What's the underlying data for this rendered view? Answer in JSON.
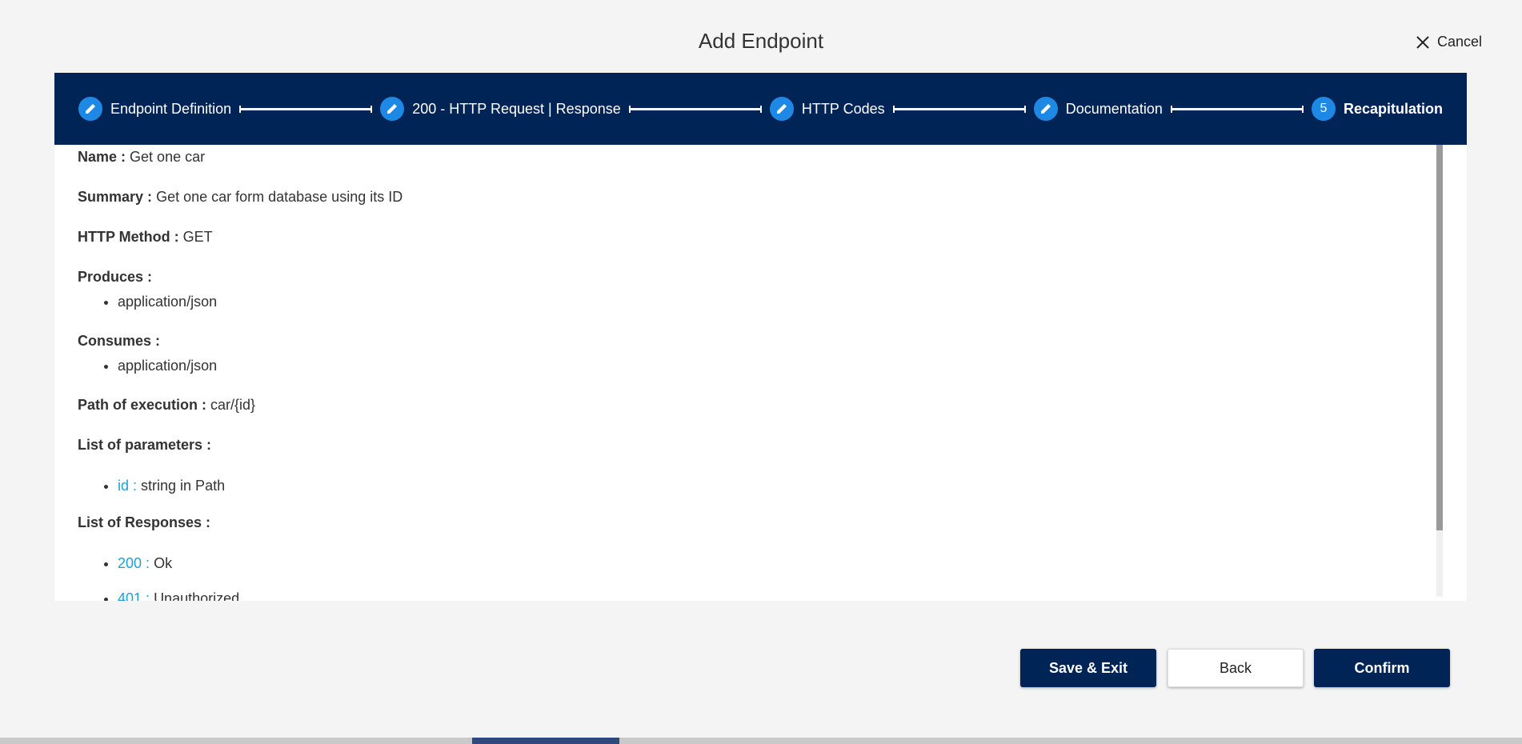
{
  "dialog": {
    "title": "Add Endpoint",
    "cancel_label": "Cancel"
  },
  "stepper": {
    "steps": [
      {
        "label": "Endpoint Definition",
        "icon": "pencil-icon",
        "state": "done"
      },
      {
        "label": "200 - HTTP Request | Response",
        "icon": "pencil-icon",
        "state": "done"
      },
      {
        "label": "HTTP Codes",
        "icon": "pencil-icon",
        "state": "done"
      },
      {
        "label": "Documentation",
        "icon": "pencil-icon",
        "state": "done"
      },
      {
        "label": "Recapitulation",
        "number": "5",
        "state": "active"
      }
    ]
  },
  "summary": {
    "name_label": "Name :",
    "name_value": "Get one car",
    "summary_label": "Summary :",
    "summary_value": "Get one car form database using its ID",
    "method_label": "HTTP Method :",
    "method_value": "GET",
    "produces_label": "Produces :",
    "produces": [
      "application/json"
    ],
    "consumes_label": "Consumes :",
    "consumes": [
      "application/json"
    ],
    "path_label": "Path of execution :",
    "path_value": "car/{id}",
    "parameters_label": "List of parameters :",
    "parameters": [
      {
        "key": "id :",
        "value": "string in Path"
      }
    ],
    "responses_label": "List of Responses :",
    "responses": [
      {
        "key": "200 :",
        "value": "Ok"
      },
      {
        "key": "401 :",
        "value": "Unauthorized"
      }
    ]
  },
  "actions": {
    "save_exit_label": "Save & Exit",
    "back_label": "Back",
    "confirm_label": "Confirm"
  },
  "colors": {
    "primary": "#002456",
    "step_circle": "#1e88e5",
    "key_text": "#1ea1d6"
  }
}
